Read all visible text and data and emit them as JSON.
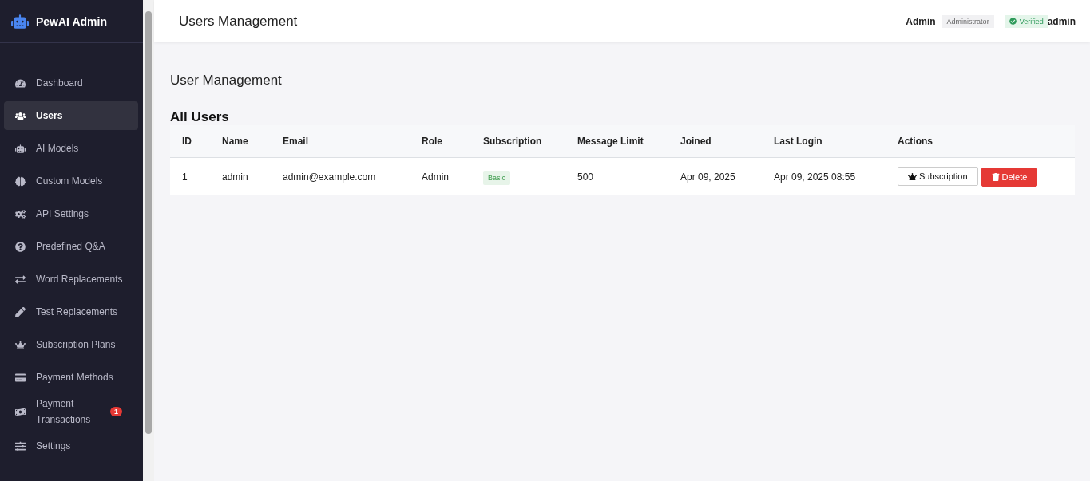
{
  "sidebar": {
    "brand": "PewAI Admin",
    "items": [
      {
        "label": "Dashboard",
        "selected": false
      },
      {
        "label": "Users",
        "selected": true
      },
      {
        "label": "AI Models",
        "selected": false
      },
      {
        "label": "Custom Models",
        "selected": false
      },
      {
        "label": "API Settings",
        "selected": false
      },
      {
        "label": "Predefined Q&A",
        "selected": false
      },
      {
        "label": "Word Replacements",
        "selected": false
      },
      {
        "label": "Test Replacements",
        "selected": false
      },
      {
        "label": "Subscription Plans",
        "selected": false
      },
      {
        "label": "Payment Methods",
        "selected": false
      },
      {
        "label": "Payment Transactions",
        "selected": false,
        "badge": "1"
      },
      {
        "label": "Settings",
        "selected": false
      }
    ]
  },
  "header": {
    "title": "Users Management",
    "user_name": "Admin",
    "role_badge": "Administrator",
    "verified_badge": "Verified",
    "username": "admin"
  },
  "page": {
    "heading": "User Management"
  },
  "table": {
    "title": "All Users",
    "columns": [
      "ID",
      "Name",
      "Email",
      "Role",
      "Subscription",
      "Message Limit",
      "Joined",
      "Last Login",
      "Actions"
    ],
    "rows": [
      {
        "cells": [
          {
            "kind": "text",
            "text": "1"
          },
          {
            "kind": "text",
            "text": "admin"
          },
          {
            "kind": "text",
            "text": "admin@example.com"
          },
          {
            "kind": "text",
            "text": "Admin"
          },
          {
            "kind": "badge",
            "text": "Basic"
          },
          {
            "kind": "text",
            "text": "500"
          },
          {
            "kind": "text",
            "text": "Apr 09, 2025"
          },
          {
            "kind": "text",
            "text": "Apr 09, 2025 08:55"
          },
          {
            "kind": "actions",
            "buttons": [
              {
                "kind": "subscription",
                "label": "Subscription"
              },
              {
                "kind": "delete",
                "label": "Delete"
              }
            ]
          }
        ]
      }
    ]
  }
}
